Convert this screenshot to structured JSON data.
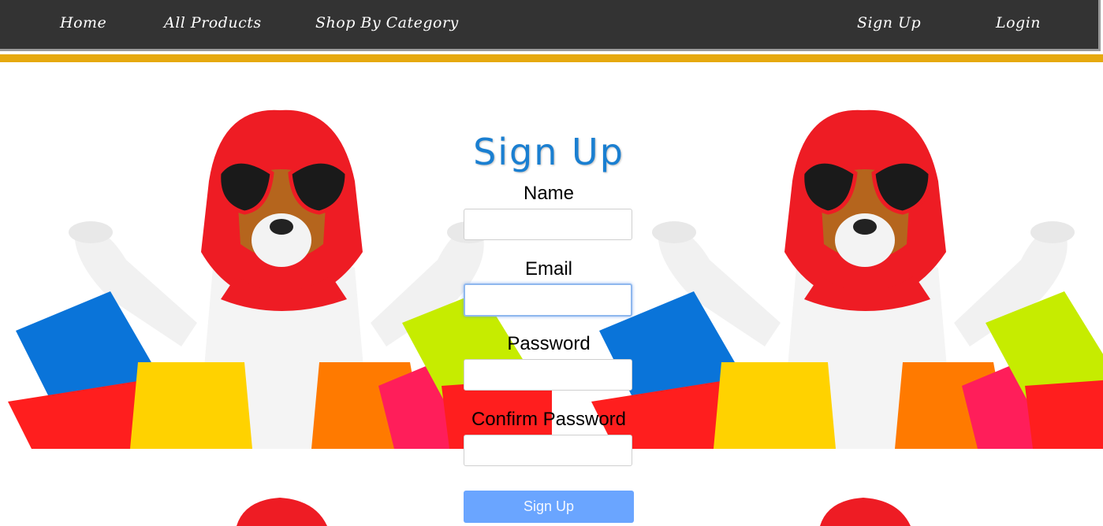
{
  "nav": {
    "home": "Home",
    "all_products": "All Products",
    "shop_by_category": "Shop By Category",
    "sign_up": "Sign Up",
    "login": "Login"
  },
  "colors": {
    "navbar": "#333333",
    "accent_bar": "#e6a90f",
    "title": "#1a7fd1",
    "button": "#6aa5ff"
  },
  "form": {
    "title": "Sign Up",
    "name_label": "Name",
    "name_value": "",
    "email_label": "Email",
    "email_value": "",
    "password_label": "Password",
    "password_value": "",
    "confirm_label": "Confirm Password",
    "confirm_value": "",
    "submit_label": "Sign Up"
  }
}
